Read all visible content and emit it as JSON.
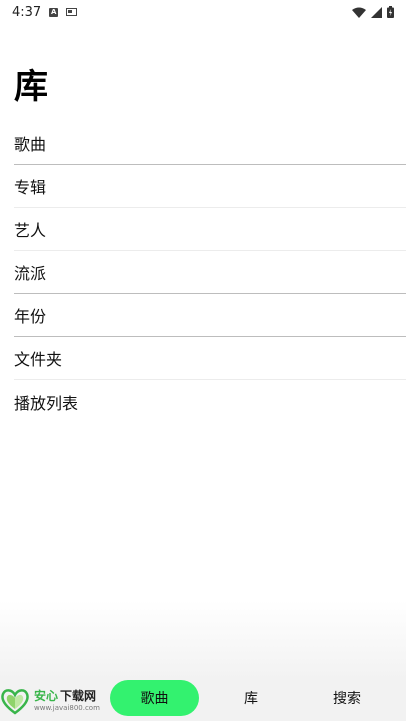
{
  "status_bar": {
    "time": "4:37",
    "icons": [
      "a-notification-icon",
      "sim-card-icon",
      "wifi-icon",
      "signal-icon",
      "battery-icon"
    ]
  },
  "page": {
    "title": "库"
  },
  "menu": {
    "items": [
      {
        "label": "歌曲"
      },
      {
        "label": "专辑"
      },
      {
        "label": "艺人"
      },
      {
        "label": "流派"
      },
      {
        "label": "年份"
      },
      {
        "label": "文件夹"
      },
      {
        "label": "播放列表"
      }
    ]
  },
  "bottom_nav": {
    "tabs": [
      {
        "label": "歌曲",
        "active": true
      },
      {
        "label": "库",
        "active": false
      },
      {
        "label": "搜索",
        "active": false
      }
    ],
    "accent_color": "#33f26f"
  },
  "watermark": {
    "brand_part1": "安心",
    "brand_part2": "下载网",
    "url": "www.javai800.com"
  }
}
